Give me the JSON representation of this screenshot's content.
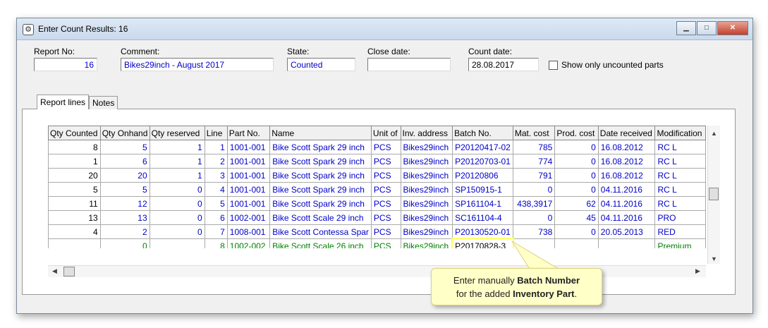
{
  "window": {
    "title": "Enter Count Results: 16"
  },
  "header": {
    "report_no_label": "Report No:",
    "report_no": "16",
    "comment_label": "Comment:",
    "comment": "Bikes29inch - August 2017",
    "state_label": "State:",
    "state": "Counted",
    "close_date_label": "Close date:",
    "close_date": "",
    "count_date_label": "Count date:",
    "count_date": "28.08.2017",
    "uncounted_label": "Show only uncounted parts"
  },
  "tabs": [
    "Report lines",
    "Notes"
  ],
  "grid": {
    "columns": [
      "Qty Counted",
      "Qty Onhand",
      "Qty reserved",
      "Line",
      "Part No.",
      "Name",
      "Unit of",
      "Inv. address",
      "Batch No.",
      "Mat. cost",
      "Prod. cost",
      "Date received",
      "Modification"
    ],
    "rows": [
      [
        "8",
        "5",
        "1",
        "1",
        "1001-001",
        "Bike Scott Spark 29 inch",
        "PCS",
        "Bikes29inch",
        "P20120417-02",
        "785",
        "0",
        "16.08.2012",
        "RC L"
      ],
      [
        "1",
        "6",
        "1",
        "2",
        "1001-001",
        "Bike Scott Spark 29 inch",
        "PCS",
        "Bikes29inch",
        "P20120703-01",
        "774",
        "0",
        "16.08.2012",
        "RC L"
      ],
      [
        "20",
        "20",
        "1",
        "3",
        "1001-001",
        "Bike Scott Spark 29 inch",
        "PCS",
        "Bikes29inch",
        "P20120806",
        "791",
        "0",
        "16.08.2012",
        "RC L"
      ],
      [
        "5",
        "5",
        "0",
        "4",
        "1001-001",
        "Bike Scott Spark 29 inch",
        "PCS",
        "Bikes29inch",
        "SP150915-1",
        "0",
        "0",
        "04.11.2016",
        "RC L"
      ],
      [
        "11",
        "12",
        "0",
        "5",
        "1001-001",
        "Bike Scott Spark 29 inch",
        "PCS",
        "Bikes29inch",
        "SP161104-1",
        "438,3917",
        "62",
        "04.11.2016",
        "RC L"
      ],
      [
        "13",
        "13",
        "0",
        "6",
        "1002-001",
        "Bike Scott Scale 29 inch",
        "PCS",
        "Bikes29inch",
        "SC161104-4",
        "0",
        "45",
        "04.11.2016",
        "PRO"
      ],
      [
        "4",
        "2",
        "0",
        "7",
        "1008-001",
        "Bike Scott Contessa Spar",
        "PCS",
        "Bikes29inch",
        "P20130520-01",
        "738",
        "0",
        "20.05.2013",
        "RED"
      ],
      [
        "",
        "0",
        "",
        "8",
        "1002-002",
        "Bike Scott Scale 26 inch",
        "PCS",
        "Bikes29inch",
        "P20170828-3",
        "",
        "",
        "",
        "Premium"
      ]
    ]
  },
  "callout": {
    "line1_prefix": "Enter manually ",
    "line1_bold": "Batch Number",
    "line2_prefix": "for the added ",
    "line2_bold": "Inventory Part",
    "line2_suffix": "."
  },
  "colors": {
    "value_blue": "#0000c8",
    "new_row_green": "#008000",
    "callout_bg": "#ffffc8",
    "highlight": "#ffff66"
  }
}
